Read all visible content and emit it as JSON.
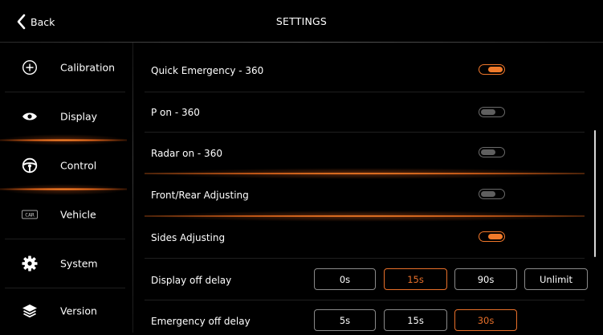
{
  "header": {
    "back_label": "Back",
    "title": "SETTINGS"
  },
  "sidebar": {
    "items": [
      {
        "label": "Calibration",
        "icon": "plus-circle-icon"
      },
      {
        "label": "Display",
        "icon": "eye-icon"
      },
      {
        "label": "Control",
        "icon": "steering-wheel-icon",
        "selected": true
      },
      {
        "label": "Vehicle",
        "icon": "car-badge-icon",
        "icon_text": "CAR"
      },
      {
        "label": "System",
        "icon": "gear-icon"
      },
      {
        "label": "Version",
        "icon": "layers-icon"
      }
    ]
  },
  "settings": {
    "toggles": [
      {
        "label": "Quick Emergency - 360",
        "on": true
      },
      {
        "label": "P on - 360",
        "on": false
      },
      {
        "label": "Radar on - 360",
        "on": false
      },
      {
        "label": "Front/Rear Adjusting",
        "on": false
      },
      {
        "label": "Sides Adjusting",
        "on": true
      }
    ],
    "display_off_delay": {
      "label": "Display off delay",
      "options": [
        "0s",
        "15s",
        "90s",
        "Unlimit"
      ],
      "selected": "15s"
    },
    "emergency_off_delay": {
      "label": "Emergency off delay",
      "options": [
        "5s",
        "15s",
        "30s"
      ],
      "selected": "30s"
    }
  },
  "colors": {
    "accent": "#f0772a",
    "background": "#000000",
    "toggle_off": "#5f5f5f"
  }
}
